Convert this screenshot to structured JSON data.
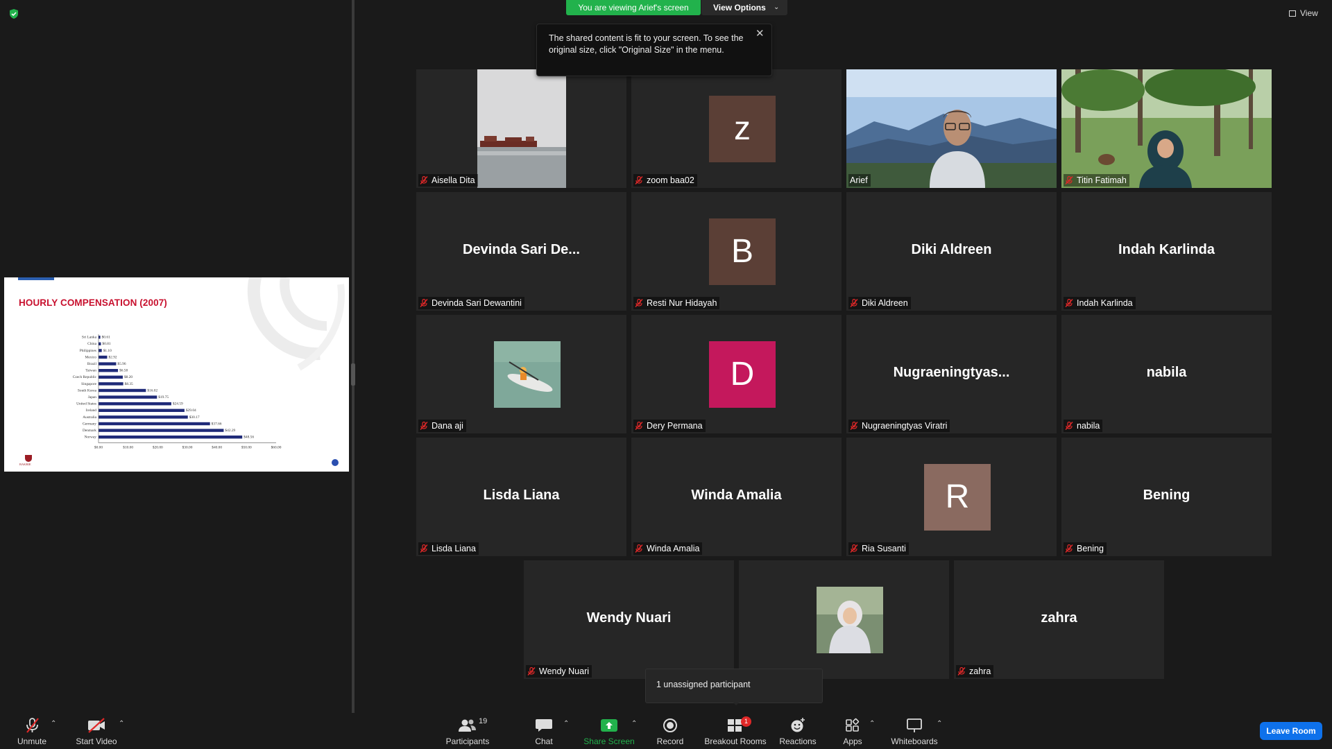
{
  "banner": {
    "viewing": "You are viewing Arief's screen",
    "view_options": "View Options",
    "view": "View"
  },
  "tooltip": {
    "text": "The shared content is fit to your screen. To see the original size, click \"Original Size\" in the menu."
  },
  "slide": {
    "title": "HOURLY COMPENSATION (2007)",
    "logo_text": "BAKRIE"
  },
  "chart_data": {
    "type": "bar",
    "orientation": "horizontal",
    "title": "HOURLY COMPENSATION (2007)",
    "categories": [
      "Sri Lanka",
      "China",
      "Philippines",
      "Mexico",
      "Brazil",
      "Taiwan",
      "Czech Republic",
      "Singapore",
      "South Korea",
      "Japan",
      "United States",
      "Ireland",
      "Australia",
      "Germany",
      "Denmark",
      "Norway"
    ],
    "values": [
      0.61,
      0.81,
      1.1,
      2.92,
      5.96,
      6.58,
      8.2,
      8.35,
      16.02,
      19.75,
      24.59,
      29.04,
      30.17,
      37.66,
      42.29,
      48.56
    ],
    "value_labels": [
      "$0.61",
      "$0.81",
      "$1.10",
      "$2.92",
      "$5.96",
      "$6.58",
      "$8.20",
      "$8.35",
      "$16.02",
      "$19.75",
      "$24.59",
      "$29.04",
      "$30.17",
      "$37.66",
      "$42.29",
      "$48.56"
    ],
    "xticks": [
      "$0.00",
      "$10.00",
      "$20.00",
      "$30.00",
      "$40.00",
      "$50.00",
      "$60.00"
    ],
    "xlim": [
      0,
      60
    ],
    "bar_color": "#1f2a78",
    "legend": "none",
    "grid": false
  },
  "tiles": [
    {
      "label": "Aisella Dita",
      "kind": "photo",
      "photo": "sea-pier"
    },
    {
      "label": "zoom baa02",
      "kind": "avatar",
      "letter": "z",
      "color": "#5b3f36"
    },
    {
      "label": "Arief",
      "kind": "video",
      "photo": "man-mountains",
      "active": true
    },
    {
      "label": "Titin Fatimah",
      "kind": "video",
      "photo": "woman-park"
    },
    {
      "label": "Devinda Sari Dewantini",
      "kind": "name",
      "display": "Devinda Sari De..."
    },
    {
      "label": "Resti Nur Hidayah",
      "kind": "avatar",
      "letter": "B",
      "color": "#5b3f36"
    },
    {
      "label": "Diki Aldreen",
      "kind": "name",
      "display": "Diki Aldreen"
    },
    {
      "label": "Indah Karlinda",
      "kind": "name",
      "display": "Indah Karlinda"
    },
    {
      "label": "Dana aji",
      "kind": "photo",
      "photo": "kayak"
    },
    {
      "label": "Dery Permana",
      "kind": "avatar",
      "letter": "D",
      "color": "#c4185c"
    },
    {
      "label": "Nugraeningtyas Viratri",
      "kind": "name",
      "display": "Nugraeningtyas..."
    },
    {
      "label": "nabila",
      "kind": "name",
      "display": "nabila"
    },
    {
      "label": "Lisda Liana",
      "kind": "name",
      "display": "Lisda Liana"
    },
    {
      "label": "Winda Amalia",
      "kind": "name",
      "display": "Winda Amalia"
    },
    {
      "label": "Ria Susanti",
      "kind": "avatar",
      "letter": "R",
      "color": "#8a6a60"
    },
    {
      "label": "Bening",
      "kind": "name",
      "display": "Bening"
    },
    {
      "label": "Wendy Nuari",
      "kind": "name",
      "display": "Wendy Nuari"
    },
    {
      "label": "",
      "kind": "photo",
      "photo": "hijab-woman"
    },
    {
      "label": "zahra",
      "kind": "name",
      "display": "zahra"
    }
  ],
  "popup": {
    "unassigned": "1 unassigned participant"
  },
  "toolbar": {
    "unmute": "Unmute",
    "start_video": "Start Video",
    "participants": "Participants",
    "participants_count": "19",
    "chat": "Chat",
    "share_screen": "Share Screen",
    "record": "Record",
    "breakout_rooms": "Breakout Rooms",
    "breakout_badge": "1",
    "reactions": "Reactions",
    "apps": "Apps",
    "whiteboards": "Whiteboards",
    "leave_room": "Leave Room"
  },
  "colors": {
    "share_green": "#22b24c",
    "active_speaker": "#d6f25b",
    "leave_blue": "#0e71eb",
    "muted_red": "#e02828",
    "slide_title_red": "#c8102e"
  }
}
